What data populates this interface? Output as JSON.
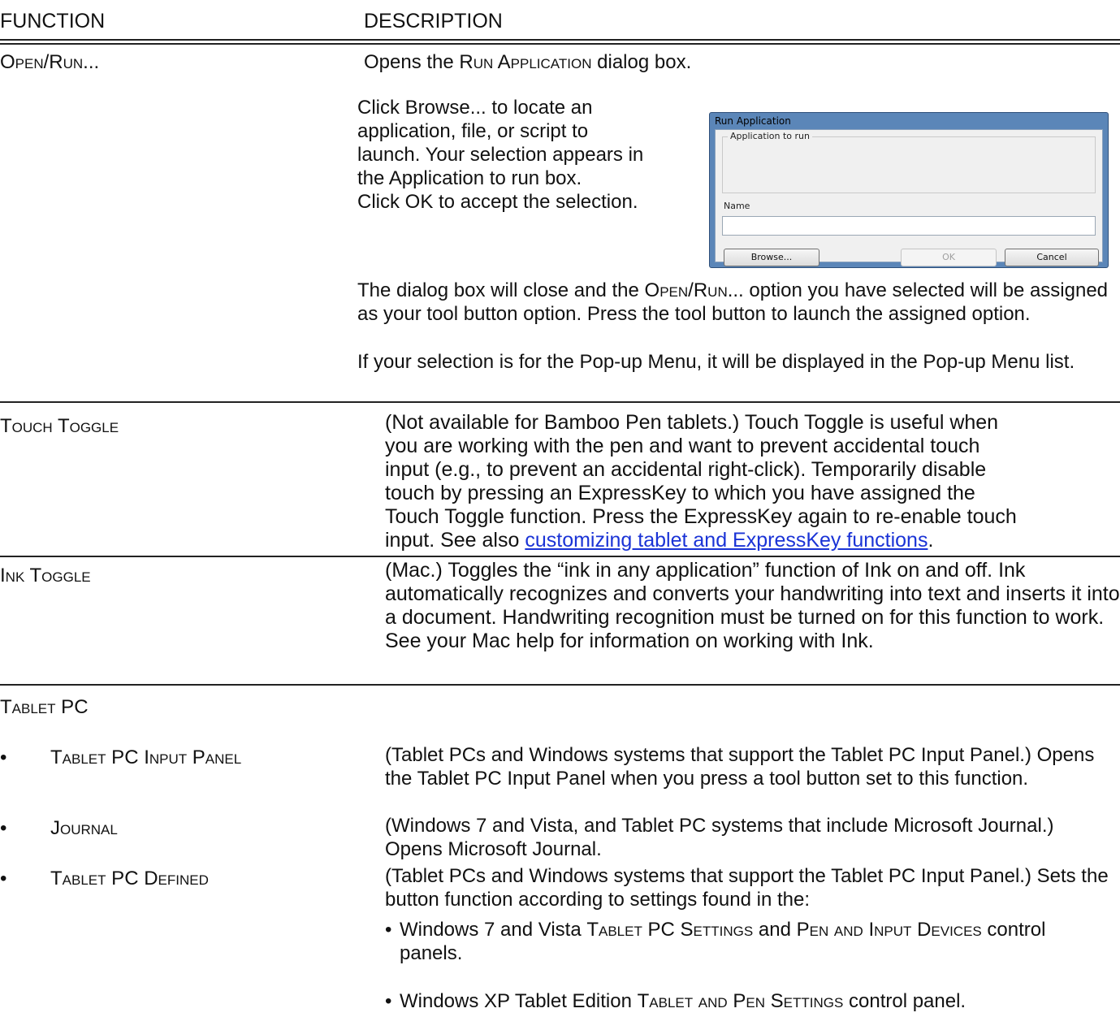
{
  "header": {
    "function": "FUNCTION",
    "description": "DESCRIPTION"
  },
  "open_run": {
    "label": "Open/Run...",
    "intro_a": "Opens the ",
    "intro_sc": "Run Application",
    "intro_b": " dialog box.",
    "click_lines": [
      "Click Browse... to locate an",
      "application, file, or script to",
      "launch. Your selection appears in",
      "the Application to run box.",
      "Click OK to accept the selection."
    ],
    "close_text_a": "The dialog box will close and the ",
    "close_text_sc": "Open/Run...",
    "close_text_b": " option you have selected will be assigned as your tool button option. Press the tool button to launch the assigned option.",
    "popup_text": "If your selection is for the Pop-up Menu, it will be displayed in the Pop-up Menu list."
  },
  "dialog": {
    "title": "Run Application",
    "group_label": "Application to run",
    "name_label": "Name",
    "name_value": "",
    "browse_label": "Browse...",
    "ok_label": "OK",
    "cancel_label": "Cancel"
  },
  "touch_toggle": {
    "label": "Touch Toggle",
    "lines": [
      "(Not available for Bamboo Pen tablets.) Touch Toggle is useful when",
      "you are working with the pen and want to prevent accidental touch",
      "input (e.g., to prevent an accidental right-click). Temporarily disable",
      "touch by pressing an ExpressKey to which you have assigned the",
      "Touch Toggle function. Press the ExpressKey again to re-enable touch"
    ],
    "last_a": "input. See also ",
    "link": "customizing tablet and ExpressKey functions",
    "last_b": "."
  },
  "ink_toggle": {
    "label": "Ink Toggle",
    "text": "(Mac.) Toggles the “ink in any application” function of Ink on and off. Ink automatically recognizes and converts your handwriting into text and inserts it into a document. Handwriting recognition must be turned on for this function to work. See your Mac help for information on working with Ink."
  },
  "tablet_pc": {
    "label": "Tablet PC",
    "bullet": "•",
    "items": [
      {
        "label": "Tablet PC Input Panel",
        "text": "(Tablet PCs and Windows systems that support the Tablet PC Input Panel.) Opens the Tablet PC Input Panel when you press a tool button set to this function."
      },
      {
        "label": "Journal",
        "text": "(Windows 7 and Vista, and Tablet PC systems that include Microsoft Journal.) Opens Microsoft Journal."
      },
      {
        "label": "Tablet PC Defined",
        "text": "(Tablet PCs and Windows systems that support the Tablet PC Input Panel.) Sets the button function according to settings found in the:"
      }
    ],
    "sub_bullets": [
      {
        "a": "Windows 7 and Vista ",
        "sc1": "Tablet PC Settings",
        "b": " and ",
        "sc2": "Pen and Input Devices",
        "c": " control panels."
      },
      {
        "a": "Windows XP Tablet Edition ",
        "sc1": "Tablet and Pen Settings",
        "b": " control panel.",
        "sc2": "",
        "c": ""
      }
    ]
  }
}
